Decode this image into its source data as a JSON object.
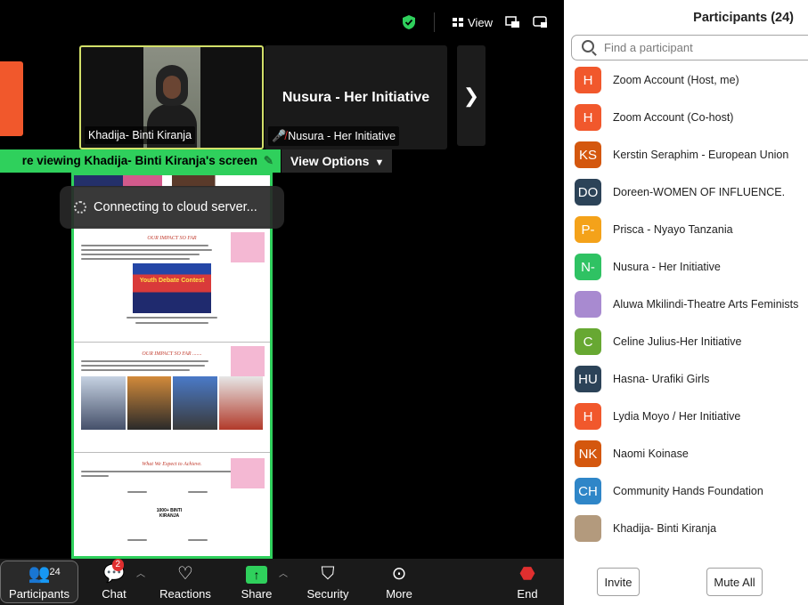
{
  "topbar": {
    "view_label": "View"
  },
  "strip": {
    "khadija_name": "Khadija- Binti Kiranja",
    "nusura_big": "Nusura - Her Initiative",
    "nusura_name": "Nusura - Her Initiative"
  },
  "share_bar": {
    "viewing_text": "re viewing  Khadija- Binti Kiranja's screen",
    "view_options_label": "View Options"
  },
  "toast": {
    "text": "Connecting to cloud server..."
  },
  "doc": {
    "heading1": "OUR IMPACT SO FAR",
    "banner_text": "Youth Debate Contest",
    "heading2": "OUR IMPACT SO FAR .......",
    "heading3": "What We Expect to Achieve.",
    "center_text": "1000+ BINTI KIRANJA"
  },
  "toolbar": {
    "participants_label": "Participants",
    "participants_count": "24",
    "chat_label": "Chat",
    "chat_badge": "2",
    "reactions_label": "Reactions",
    "share_label": "Share",
    "security_label": "Security",
    "more_label": "More",
    "end_label": "End"
  },
  "panel": {
    "title": "Participants (24)",
    "search_placeholder": "Find a participant",
    "invite_label": "Invite",
    "mute_all_label": "Mute All",
    "participants": [
      {
        "initials": "H",
        "name": "Zoom Account (Host, me)",
        "color": "#f1582c"
      },
      {
        "initials": "H",
        "name": "Zoom Account (Co-host)",
        "color": "#f1582c"
      },
      {
        "initials": "KS",
        "name": "Kerstin Seraphim - European Union",
        "color": "#d4570e"
      },
      {
        "initials": "DO",
        "name": "Doreen-WOMEN OF INFLUENCE.",
        "color": "#2c4358"
      },
      {
        "initials": "P-",
        "name": "Prisca - Nyayo Tanzania",
        "color": "#f4a21a"
      },
      {
        "initials": "N-",
        "name": "Nusura - Her Initiative",
        "color": "#2fc263"
      },
      {
        "initials": "",
        "name": "Aluwa Mkilindi-Theatre Arts Feminists",
        "color": "#a88ad0"
      },
      {
        "initials": "C",
        "name": "Celine Julius-Her Initiative",
        "color": "#67a832"
      },
      {
        "initials": "HU",
        "name": "Hasna- Urafiki Girls",
        "color": "#2c4358"
      },
      {
        "initials": "H",
        "name": "Lydia Moyo / Her Initiative",
        "color": "#f1582c"
      },
      {
        "initials": "NK",
        "name": "Naomi Koinase",
        "color": "#d4570e"
      },
      {
        "initials": "CH",
        "name": "Community Hands Foundation",
        "color": "#2f86c8"
      },
      {
        "initials": "",
        "name": "Khadija- Binti Kiranja",
        "color": "#b39a7d"
      }
    ]
  }
}
